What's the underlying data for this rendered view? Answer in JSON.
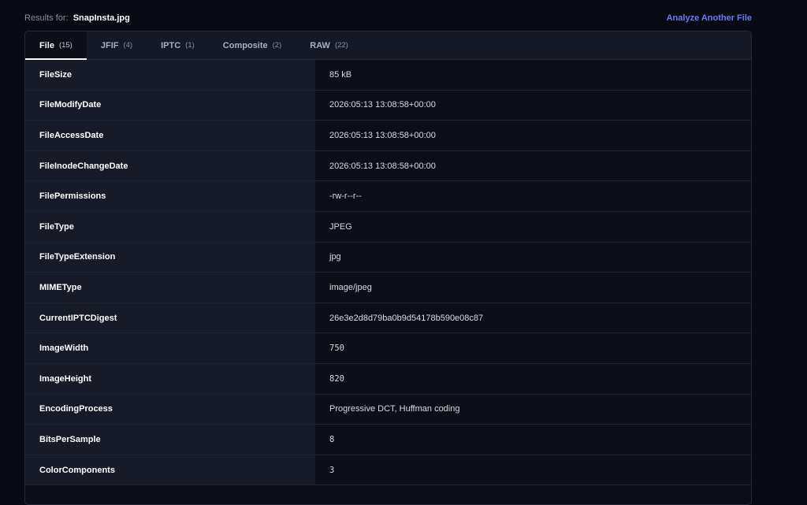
{
  "header": {
    "results_label": "Results for:",
    "file_name": "SnapInsta.jpg",
    "analyze_link": "Analyze Another File"
  },
  "tabs": [
    {
      "label": "File",
      "count": "(15)",
      "active": true
    },
    {
      "label": "JFIF",
      "count": "(4)",
      "active": false
    },
    {
      "label": "IPTC",
      "count": "(1)",
      "active": false
    },
    {
      "label": "Composite",
      "count": "(2)",
      "active": false
    },
    {
      "label": "RAW",
      "count": "(22)",
      "active": false
    }
  ],
  "rows": [
    {
      "key": "FileSize",
      "value": "85 kB",
      "mono": false
    },
    {
      "key": "FileModifyDate",
      "value": "2026:05:13 13:08:58+00:00",
      "mono": false
    },
    {
      "key": "FileAccessDate",
      "value": "2026:05:13 13:08:58+00:00",
      "mono": false
    },
    {
      "key": "FileInodeChangeDate",
      "value": "2026:05:13 13:08:58+00:00",
      "mono": false
    },
    {
      "key": "FilePermissions",
      "value": "-rw-r--r--",
      "mono": false
    },
    {
      "key": "FileType",
      "value": "JPEG",
      "mono": false
    },
    {
      "key": "FileTypeExtension",
      "value": "jpg",
      "mono": false
    },
    {
      "key": "MIMEType",
      "value": "image/jpeg",
      "mono": false
    },
    {
      "key": "CurrentIPTCDigest",
      "value": "26e3e2d8d79ba0b9d54178b590e08c87",
      "mono": false
    },
    {
      "key": "ImageWidth",
      "value": "750",
      "mono": true
    },
    {
      "key": "ImageHeight",
      "value": "820",
      "mono": true
    },
    {
      "key": "EncodingProcess",
      "value": "Progressive DCT, Huffman coding",
      "mono": false
    },
    {
      "key": "BitsPerSample",
      "value": "8",
      "mono": true
    },
    {
      "key": "ColorComponents",
      "value": "3",
      "mono": true
    }
  ]
}
